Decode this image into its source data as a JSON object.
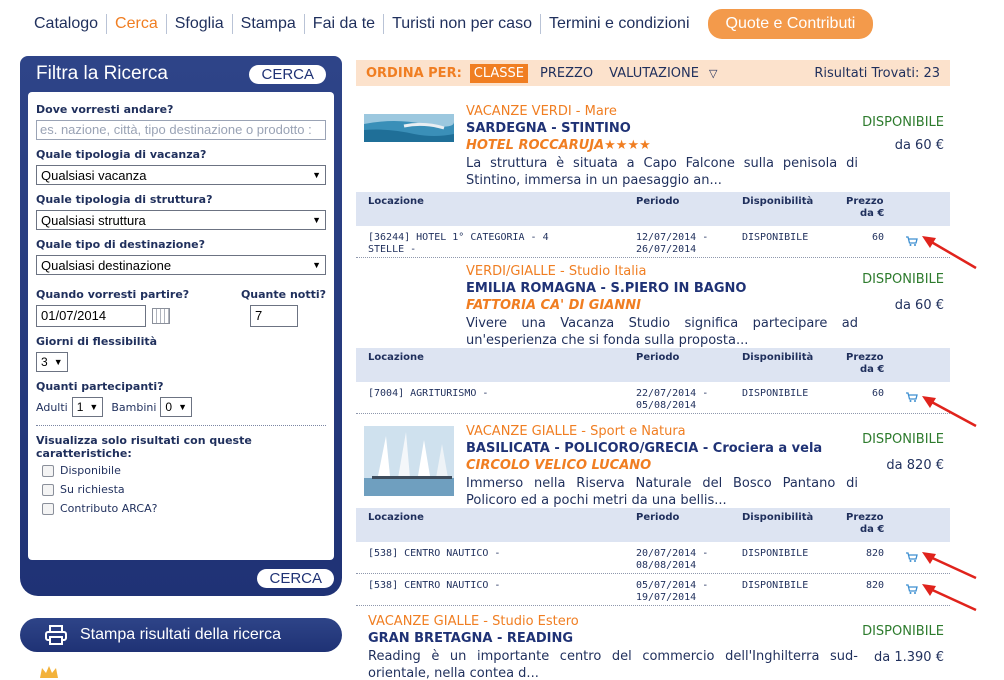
{
  "nav": {
    "items": [
      {
        "label": "Catalogo",
        "active": false
      },
      {
        "label": "Cerca",
        "active": true
      },
      {
        "label": "Sfoglia",
        "active": false
      },
      {
        "label": "Stampa",
        "active": false
      },
      {
        "label": "Fai da te",
        "active": false
      },
      {
        "label": "Turisti non per caso",
        "active": false
      },
      {
        "label": "Termini e condizioni",
        "active": false
      }
    ],
    "quote_button": "Quote e Contributi"
  },
  "filter": {
    "title": "Filtra la Ricerca",
    "search_button": "CERCA",
    "where_label": "Dove vorresti andare?",
    "where_placeholder": "es. nazione, città, tipo destinazione o prodotto :",
    "holiday_type_label": "Quale tipologia di vacanza?",
    "holiday_type_value": "Qualsiasi vacanza",
    "structure_type_label": "Quale tipologia di struttura?",
    "structure_type_value": "Qualsiasi struttura",
    "destination_type_label": "Quale tipo di destinazione?",
    "destination_type_value": "Qualsiasi destinazione",
    "depart_label": "Quando vorresti partire?",
    "depart_value": "01/07/2014",
    "nights_label": "Quante notti?",
    "nights_value": "7",
    "flex_label": "Giorni di flessibilità",
    "flex_value": "3",
    "participants_label": "Quanti partecipanti?",
    "adults_label": "Adulti",
    "adults_value": "1",
    "children_label": "Bambini",
    "children_value": "0",
    "features_label": "Visualizza solo risultati con queste caratteristiche:",
    "features": [
      "Disponibile",
      "Su richiesta",
      "Contributo ARCA?"
    ],
    "search_button_bottom": "CERCA"
  },
  "print_button": "Stampa risultati della ricerca",
  "sort": {
    "label": "ORDINA PER:",
    "options": [
      "CLASSE",
      "PREZZO",
      "VALUTAZIONE"
    ],
    "found_label": "Risultati Trovati: 23"
  },
  "table_headers": {
    "location": "Locazione",
    "period": "Periodo",
    "availability": "Disponibilità",
    "price_line1": "Prezzo",
    "price_line2": "da €"
  },
  "offers": [
    {
      "category": "VACANZE VERDI - Mare",
      "destination": "SARDEGNA - STINTINO",
      "hotel": "HOTEL ROCCARUJA★★★★",
      "description": "La struttura è situata a Capo Falcone sulla penisola di Stintino, immersa in un paesaggio an...",
      "availability": "DISPONIBILE",
      "price": "da 60 €",
      "rows": [
        {
          "location_1": "[36244] HOTEL 1° CATEGORIA - 4",
          "location_2": "STELLE -",
          "period_1": "12/07/2014 -",
          "period_2": "26/07/2014",
          "availability": "DISPONIBILE",
          "price": "60"
        }
      ]
    },
    {
      "category": "VERDI/GIALLE - Studio Italia",
      "destination": "EMILIA ROMAGNA - S.PIERO IN BAGNO",
      "hotel": "FATTORIA CA' DI GIANNI",
      "description": "Vivere una Vacanza Studio significa partecipare ad un'esperienza che si fonda sulla proposta...",
      "availability": "DISPONIBILE",
      "price": "da 60 €",
      "rows": [
        {
          "location_1": "[7004] AGRITURISMO -",
          "location_2": "",
          "period_1": "22/07/2014 -",
          "period_2": "05/08/2014",
          "availability": "DISPONIBILE",
          "price": "60"
        }
      ]
    },
    {
      "category": "VACANZE GIALLE - Sport e Natura",
      "destination": "BASILICATA - POLICORO/GRECIA - Crociera a vela",
      "hotel": "CIRCOLO VELICO LUCANO",
      "description": "Immerso nella Riserva Naturale del Bosco Pantano di Policoro ed a pochi metri da una bellis...",
      "availability": "DISPONIBILE",
      "price": "da 820 €",
      "rows": [
        {
          "location_1": "[538] CENTRO NAUTICO -",
          "location_2": "",
          "period_1": "20/07/2014 -",
          "period_2": "08/08/2014",
          "availability": "DISPONIBILE",
          "price": "820"
        },
        {
          "location_1": "[538] CENTRO NAUTICO -",
          "location_2": "",
          "period_1": "05/07/2014 -",
          "period_2": "19/07/2014",
          "availability": "DISPONIBILE",
          "price": "820"
        }
      ]
    },
    {
      "category": "VACANZE GIALLE - Studio Estero",
      "destination": "GRAN BRETAGNA - READING",
      "description": "Reading è un importante centro del commercio dell'Inghilterra sud-orientale, nella contea d...",
      "availability": "DISPONIBILE",
      "price": "da 1.390 €"
    }
  ],
  "colors": {
    "navy": "#1f3275",
    "orange": "#f07e22",
    "available_green": "#2d7b2d",
    "arrow_red": "#e0231c"
  }
}
